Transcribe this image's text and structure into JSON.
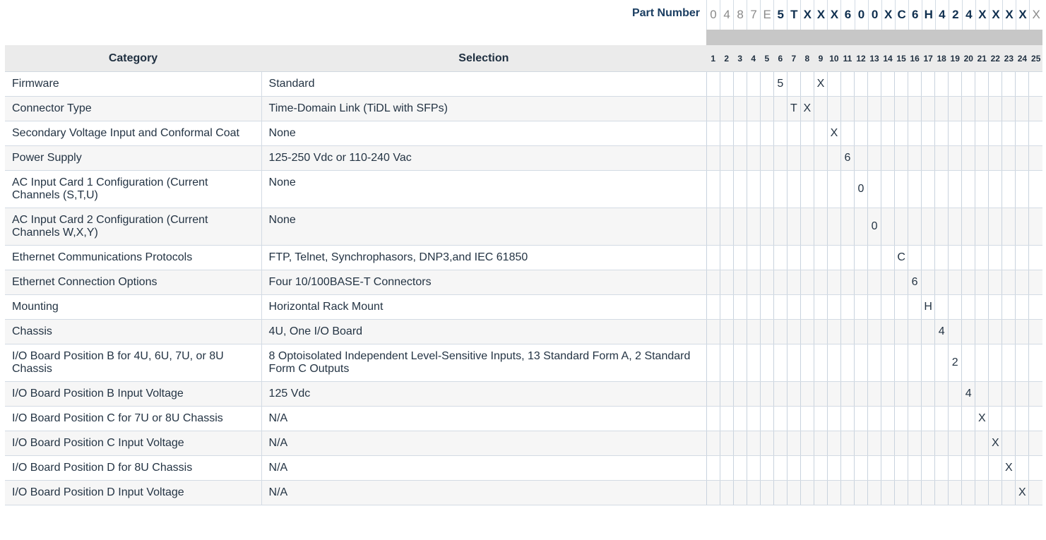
{
  "part_number": {
    "label": "Part Number",
    "chars": [
      "0",
      "4",
      "8",
      "7",
      "E",
      "5",
      "T",
      "X",
      "X",
      "X",
      "6",
      "0",
      "0",
      "X",
      "C",
      "6",
      "H",
      "4",
      "2",
      "4",
      "X",
      "X",
      "X",
      "X",
      "X"
    ]
  },
  "table": {
    "headers": {
      "category": "Category",
      "selection": "Selection"
    },
    "positions": [
      "1",
      "2",
      "3",
      "4",
      "5",
      "6",
      "7",
      "8",
      "9",
      "10",
      "11",
      "12",
      "13",
      "14",
      "15",
      "16",
      "17",
      "18",
      "19",
      "20",
      "21",
      "22",
      "23",
      "24",
      "25"
    ],
    "rows": [
      {
        "category": "Firmware",
        "selection": "Standard",
        "codes": {
          "6": "5",
          "9": "X"
        }
      },
      {
        "category": "Connector Type",
        "selection": "Time-Domain Link (TiDL with SFPs)",
        "codes": {
          "7": "T",
          "8": "X"
        }
      },
      {
        "category": "Secondary Voltage Input and Conformal Coat",
        "selection": "None",
        "codes": {
          "10": "X"
        }
      },
      {
        "category": "Power Supply",
        "selection": "125-250 Vdc or 110-240 Vac",
        "codes": {
          "11": "6"
        }
      },
      {
        "category": "AC Input Card 1 Configuration (Current Channels (S,T,U)",
        "selection": "None",
        "codes": {
          "12": "0"
        }
      },
      {
        "category": "AC Input Card 2 Configuration (Current Channels W,X,Y)",
        "selection": "None",
        "codes": {
          "13": "0"
        }
      },
      {
        "category": "Ethernet Communications Protocols",
        "selection": "FTP, Telnet, Synchrophasors, DNP3,and IEC 61850",
        "codes": {
          "15": "C"
        }
      },
      {
        "category": "Ethernet Connection Options",
        "selection": "Four 10/100BASE-T Connectors",
        "codes": {
          "16": "6"
        }
      },
      {
        "category": "Mounting",
        "selection": "Horizontal Rack Mount",
        "codes": {
          "17": "H"
        }
      },
      {
        "category": "Chassis",
        "selection": "4U, One I/O Board",
        "codes": {
          "18": "4"
        }
      },
      {
        "category": "I/O Board Position B for 4U, 6U, 7U, or 8U Chassis",
        "selection": "8 Optoisolated Independent Level-Sensitive Inputs, 13 Standard Form A, 2 Standard Form C Outputs",
        "codes": {
          "19": "2"
        }
      },
      {
        "category": "I/O Board Position B Input Voltage",
        "selection": "125 Vdc",
        "codes": {
          "20": "4"
        }
      },
      {
        "category": "I/O Board Position C for 7U or 8U Chassis",
        "selection": "N/A",
        "codes": {
          "21": "X"
        }
      },
      {
        "category": "I/O Board Position C Input Voltage",
        "selection": "N/A",
        "codes": {
          "22": "X"
        }
      },
      {
        "category": "I/O Board Position D for 8U Chassis",
        "selection": "N/A",
        "codes": {
          "23": "X"
        }
      },
      {
        "category": "I/O Board Position D Input Voltage",
        "selection": "N/A",
        "codes": {
          "24": "X"
        }
      }
    ]
  }
}
